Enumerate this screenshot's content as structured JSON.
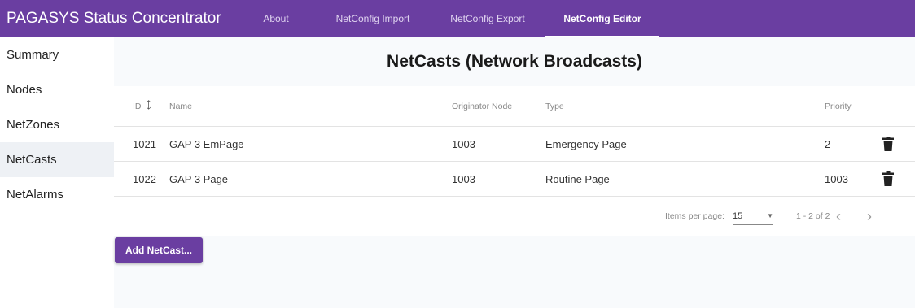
{
  "app": {
    "title": "PAGASYS Status Concentrator"
  },
  "nav": {
    "tabs": [
      {
        "label": "About"
      },
      {
        "label": "NetConfig Import"
      },
      {
        "label": "NetConfig Export"
      },
      {
        "label": "NetConfig Editor"
      }
    ],
    "active_tab": "NetConfig Editor"
  },
  "sidebar": {
    "items": [
      {
        "label": "Summary"
      },
      {
        "label": "Nodes"
      },
      {
        "label": "NetZones"
      },
      {
        "label": "NetCasts"
      },
      {
        "label": "NetAlarms"
      }
    ],
    "active_item": "NetCasts"
  },
  "main": {
    "title": "NetCasts (Network Broadcasts)",
    "table": {
      "columns": {
        "id": "ID",
        "id_sort_icon": "arrow-up-icon",
        "name": "Name",
        "originator": "Originator Node",
        "type": "Type",
        "priority": "Priority"
      },
      "rows": [
        {
          "id": "1021",
          "name": "GAP 3 EmPage",
          "originator": "1003",
          "type": "Emergency Page",
          "priority": "2"
        },
        {
          "id": "1022",
          "name": "GAP 3 Page",
          "originator": "1003",
          "type": "Routine Page",
          "priority": "1003"
        }
      ],
      "row_action_icon": "trash-icon"
    },
    "paginator": {
      "items_per_page_label": "Items per page:",
      "items_per_page_value": "15",
      "range_label": "1 - 2 of 2",
      "prev_icon": "chevron-left-icon",
      "next_icon": "chevron-right-icon"
    },
    "add_button_label": "Add NetCast..."
  },
  "colors": {
    "accent": "#6a3ea1",
    "sidebar_active_bg": "#eef1f5",
    "main_bg": "#f8fafc"
  }
}
